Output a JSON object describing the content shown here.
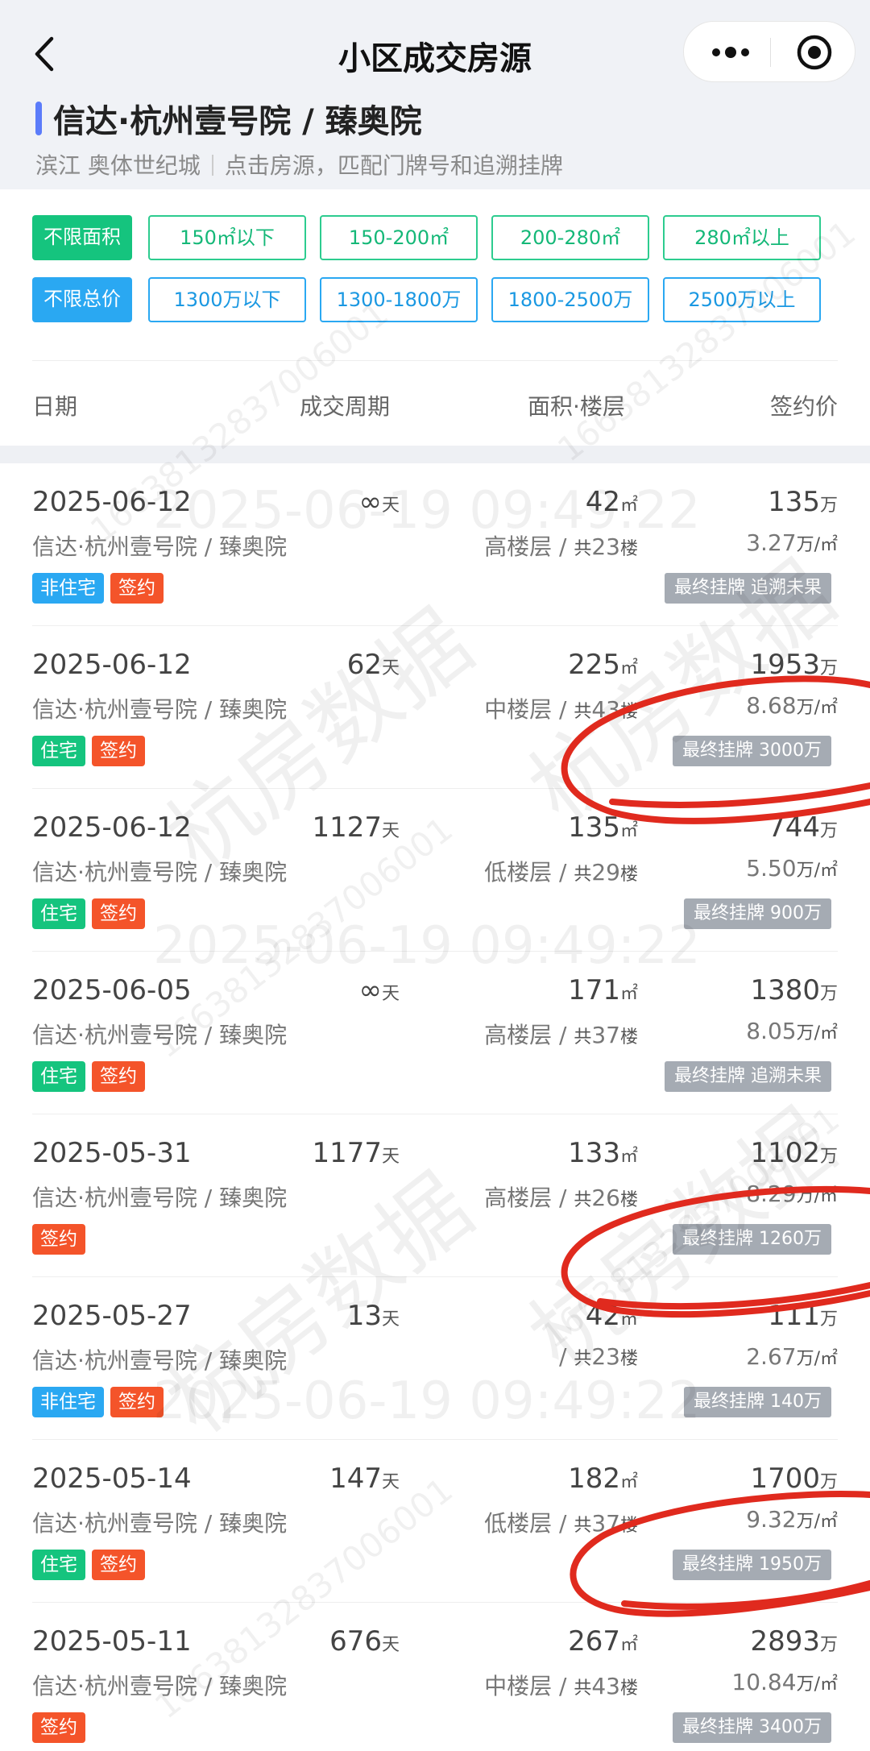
{
  "nav": {
    "title": "小区成交房源",
    "back_icon": "chevron-left-icon",
    "more_icon": "more-dots-icon",
    "close_icon": "target-circle-icon"
  },
  "community": {
    "name": "信达·杭州壹号院 / 臻奥院",
    "district": "滨江  奥体世纪城",
    "hint": "点击房源，匹配门牌号和追溯挂牌",
    "accent": "#5b7cfa"
  },
  "filters": {
    "area_label": "不限面积",
    "area_options": [
      "150㎡以下",
      "150-200㎡",
      "200-280㎡",
      "280㎡以上"
    ],
    "price_label": "不限总价",
    "price_options": [
      "1300万以下",
      "1300-1800万",
      "1800-2500万",
      "2500万以上"
    ]
  },
  "table_header": {
    "date": "日期",
    "period": "成交周期",
    "area_floor": "面积·楼层",
    "price": "签约价"
  },
  "units": {
    "day": "天",
    "sqm": "㎡",
    "wan": "万",
    "wan_per_sqm": "万/㎡",
    "total_floor_prefix": "共",
    "total_floor_suffix": "楼",
    "slash": " / "
  },
  "rows": [
    {
      "date": "2025-06-12",
      "period": "∞",
      "area": "42",
      "price": "135",
      "name": "信达·杭州壹号院 / 臻奥院",
      "floor": "高楼层",
      "total": "23",
      "unit_price": "3.27",
      "tags": [
        {
          "label": "非住宅",
          "kind": "nonres"
        },
        {
          "label": "签约",
          "kind": "signed"
        }
      ],
      "listing": "最终挂牌 追溯未果"
    },
    {
      "date": "2025-06-12",
      "period": "62",
      "area": "225",
      "price": "1953",
      "name": "信达·杭州壹号院 / 臻奥院",
      "floor": "中楼层",
      "total": "43",
      "unit_price": "8.68",
      "tags": [
        {
          "label": "住宅",
          "kind": "res"
        },
        {
          "label": "签约",
          "kind": "signed"
        }
      ],
      "listing": "最终挂牌 3000万"
    },
    {
      "date": "2025-06-12",
      "period": "1127",
      "area": "135",
      "price": "744",
      "name": "信达·杭州壹号院 / 臻奥院",
      "floor": "低楼层",
      "total": "29",
      "unit_price": "5.50",
      "tags": [
        {
          "label": "住宅",
          "kind": "res"
        },
        {
          "label": "签约",
          "kind": "signed"
        }
      ],
      "listing": "最终挂牌 900万"
    },
    {
      "date": "2025-06-05",
      "period": "∞",
      "area": "171",
      "price": "1380",
      "name": "信达·杭州壹号院 / 臻奥院",
      "floor": "高楼层",
      "total": "37",
      "unit_price": "8.05",
      "tags": [
        {
          "label": "住宅",
          "kind": "res"
        },
        {
          "label": "签约",
          "kind": "signed"
        }
      ],
      "listing": "最终挂牌 追溯未果"
    },
    {
      "date": "2025-05-31",
      "period": "1177",
      "area": "133",
      "price": "1102",
      "name": "信达·杭州壹号院 / 臻奥院",
      "floor": "高楼层",
      "total": "26",
      "unit_price": "8.29",
      "tags": [
        {
          "label": "签约",
          "kind": "signed"
        }
      ],
      "listing": "最终挂牌 1260万"
    },
    {
      "date": "2025-05-27",
      "period": "13",
      "area": "42",
      "price": "111",
      "name": "信达·杭州壹号院 / 臻奥院",
      "floor": "",
      "total": "23",
      "unit_price": "2.67",
      "tags": [
        {
          "label": "非住宅",
          "kind": "nonres"
        },
        {
          "label": "签约",
          "kind": "signed"
        }
      ],
      "listing": "最终挂牌 140万"
    },
    {
      "date": "2025-05-14",
      "period": "147",
      "area": "182",
      "price": "1700",
      "name": "信达·杭州壹号院 / 臻奥院",
      "floor": "低楼层",
      "total": "37",
      "unit_price": "9.32",
      "tags": [
        {
          "label": "住宅",
          "kind": "res"
        },
        {
          "label": "签约",
          "kind": "signed"
        }
      ],
      "listing": "最终挂牌 1950万"
    },
    {
      "date": "2025-05-11",
      "period": "676",
      "area": "267",
      "price": "2893",
      "name": "信达·杭州壹号院 / 臻奥院",
      "floor": "中楼层",
      "total": "43",
      "unit_price": "10.84",
      "tags": [
        {
          "label": "签约",
          "kind": "signed"
        }
      ],
      "listing": "最终挂牌 3400万"
    }
  ],
  "watermark": {
    "timestamp": "2025-06-19 09:49:22",
    "brand": "杭房数据",
    "id": "16638132837006001"
  },
  "colors": {
    "residential": "#15c47e",
    "non_residential": "#2aa8f2",
    "signed": "#f4542a",
    "listing_badge": "#a5abb3",
    "annotation": "#e02a1e"
  }
}
